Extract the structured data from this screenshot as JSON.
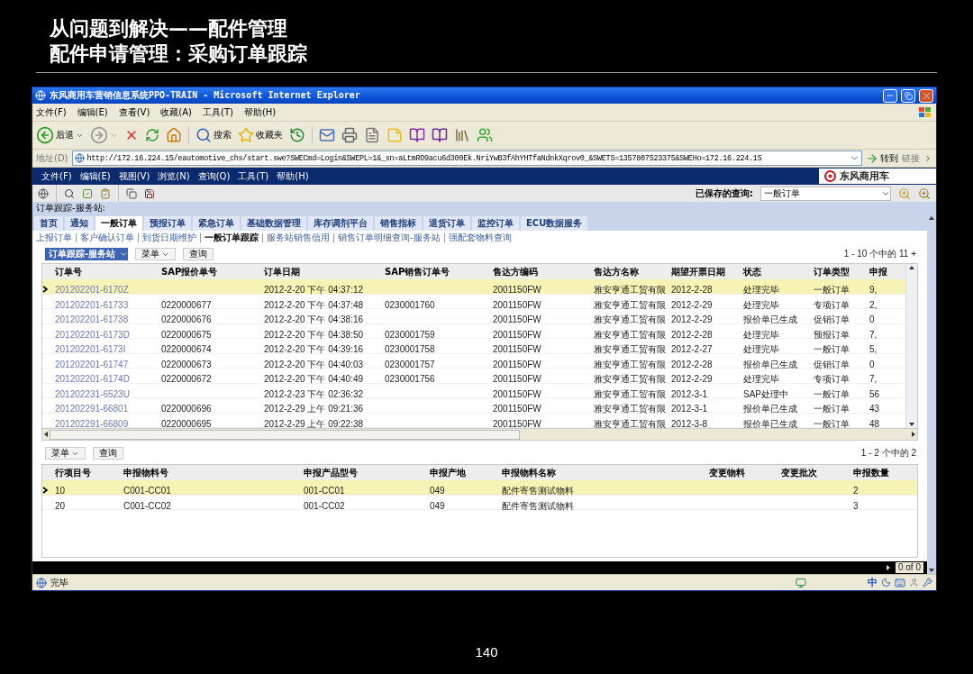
{
  "slide": {
    "title_lines": [
      "从问题到解决——配件管理",
      "配件申请管理：采购订单跟踪"
    ],
    "page_number": "140"
  },
  "window": {
    "title": "东风商用车营销信息系统PPO-TRAIN - Microsoft Internet Explorer"
  },
  "browser_menu": [
    "文件(F)",
    "编辑(E)",
    "查看(V)",
    "收藏(A)",
    "工具(T)",
    "帮助(H)"
  ],
  "browser_toolbar": {
    "back": "后退",
    "search": "搜索",
    "favorites": "收藏夹"
  },
  "address_bar": {
    "label": "地址(D)",
    "url": "http://172.16.224.15/eautomotive_chs/start.swe?SWECmd=Login&SWEPL=1&_sn=aLtmRO9acu6d300Ek.NriYwB3fAhYHTfaNdnkXqrov0_&SWETS=1357807523375&SWEHo=172.16.224.15",
    "go": "转到",
    "links": "链接"
  },
  "app_menu": [
    "文件(F)",
    "编辑(E)",
    "视图(V)",
    "浏览(N)",
    "查询(Q)",
    "工具(T)",
    "帮助(H)"
  ],
  "brand": "东风商用车",
  "saved_query": {
    "label": "已保存的查询:",
    "value": "一般订单"
  },
  "screen_title": "订单跟踪-服务站:",
  "tabs": [
    {
      "label": "首页",
      "selected": false
    },
    {
      "label": "通知",
      "selected": false
    },
    {
      "label": "一般订单",
      "selected": true
    },
    {
      "label": "预报订单",
      "selected": false
    },
    {
      "label": "紧急订单",
      "selected": false
    },
    {
      "label": "基础数据管理",
      "selected": false
    },
    {
      "label": "库存调剂平台",
      "selected": false
    },
    {
      "label": "销售指标",
      "selected": false
    },
    {
      "label": "退货订单",
      "selected": false
    },
    {
      "label": "监控订单",
      "selected": false
    },
    {
      "label": "ECU数据服务",
      "selected": false
    }
  ],
  "subnav": [
    {
      "label": "上报订单",
      "selected": false
    },
    {
      "label": "客户确认订单",
      "selected": false
    },
    {
      "label": "到货日期维护",
      "selected": false
    },
    {
      "label": "一般订单跟踪",
      "selected": true
    },
    {
      "label": "服务站销售信用",
      "selected": false
    },
    {
      "label": "销售订单明细查询-服务站",
      "selected": false
    },
    {
      "label": "强配套物料查询",
      "selected": false
    }
  ],
  "orders_applet": {
    "title": "订单跟踪-服务站",
    "menu": "菜单",
    "query": "查询",
    "count": "1 - 10 个中的 11 +",
    "columns": [
      "订单号",
      "SAP报价单号",
      "订单日期",
      "SAP销售订单号",
      "售达方编码",
      "售达方名称",
      "期望开票日期",
      "状态",
      "订单类型",
      "申报"
    ],
    "rows": [
      {
        "selected": true,
        "cells": [
          "201202201-6170Z",
          null,
          "2012-2-20 下午 04:37:12",
          null,
          "2001150FW",
          "雅安亨通工贸有限",
          "2012-2-28",
          "处理完毕",
          "一般订单",
          "9,"
        ]
      },
      {
        "selected": false,
        "cells": [
          "201202201-61733",
          "0220000677",
          "2012-2-20 下午 04:37:48",
          "0230001760",
          "2001150FW",
          "雅安亨通工贸有限",
          "2012-2-29",
          "处理完毕",
          "专项订单",
          "2,"
        ]
      },
      {
        "selected": false,
        "cells": [
          "201202201-61738",
          "0220000676",
          "2012-2-20 下午 04:38:16",
          null,
          "2001150FW",
          "雅安亨通工贸有限",
          "2012-2-29",
          "报价单已生成",
          "促销订单",
          "0"
        ]
      },
      {
        "selected": false,
        "cells": [
          "201202201-6173D",
          "0220000675",
          "2012-2-20 下午 04:38:50",
          "0230001759",
          "2001150FW",
          "雅安亨通工贸有限",
          "2012-2-28",
          "处理完毕",
          "预报订单",
          "7,"
        ]
      },
      {
        "selected": false,
        "cells": [
          "201202201-6173I",
          "0220000674",
          "2012-2-20 下午 04:39:16",
          "0230001758",
          "2001150FW",
          "雅安亨通工贸有限",
          "2012-2-27",
          "处理完毕",
          "一般订单",
          "5,"
        ]
      },
      {
        "selected": false,
        "cells": [
          "201202201-61747",
          "0220000673",
          "2012-2-20 下午 04:40:03",
          "0230001757",
          "2001150FW",
          "雅安亨通工贸有限",
          "2012-2-28",
          "报价单已生成",
          "促销订单",
          "0"
        ]
      },
      {
        "selected": false,
        "cells": [
          "201202201-6174D",
          "0220000672",
          "2012-2-20 下午 04:40:49",
          "0230001756",
          "2001150FW",
          "雅安亨通工贸有限",
          "2012-2-29",
          "处理完毕",
          "专项订单",
          "7,"
        ]
      },
      {
        "selected": false,
        "cells": [
          "201202231-6523U",
          null,
          "2012-2-23 下午 02:36:32",
          null,
          "2001150FW",
          "雅安亨通工贸有限",
          "2012-3-1",
          "SAP处理中",
          "一般订单",
          "56"
        ]
      },
      {
        "selected": false,
        "cells": [
          "201202291-66801",
          "0220000696",
          "2012-2-29 上午 09:21:36",
          null,
          "2001150FW",
          "雅安亨通工贸有限",
          "2012-3-1",
          "报价单已生成",
          "一般订单",
          "43"
        ]
      },
      {
        "selected": false,
        "cells": [
          "201202291-66809",
          "0220000695",
          "2012-2-29 上午 09:22:38",
          null,
          "2001150FW",
          "雅安亨通工贸有限",
          "2012-3-8",
          "报价单已生成",
          "一般订单",
          "48"
        ]
      }
    ]
  },
  "lines_applet": {
    "menu": "菜单",
    "query": "查询",
    "count": "1 - 2 个中的 2",
    "columns": [
      "行项目号",
      "申报物料号",
      "申报产品型号",
      "申报产地",
      "申报物料名称",
      "变更物料",
      "变更批次",
      "申报数量"
    ],
    "rows": [
      {
        "selected": true,
        "cells": [
          "10",
          "C001-CC01",
          "001-CC01",
          "049",
          "配件寄售测试物料",
          null,
          null,
          "2"
        ]
      },
      {
        "selected": false,
        "cells": [
          "20",
          "C001-CC02",
          "001-CC02",
          "049",
          "配件寄售测试物料",
          null,
          null,
          "3"
        ]
      }
    ]
  },
  "record_count": "0 of 0",
  "status_bar": {
    "text": "完毕",
    "ime": "中"
  }
}
